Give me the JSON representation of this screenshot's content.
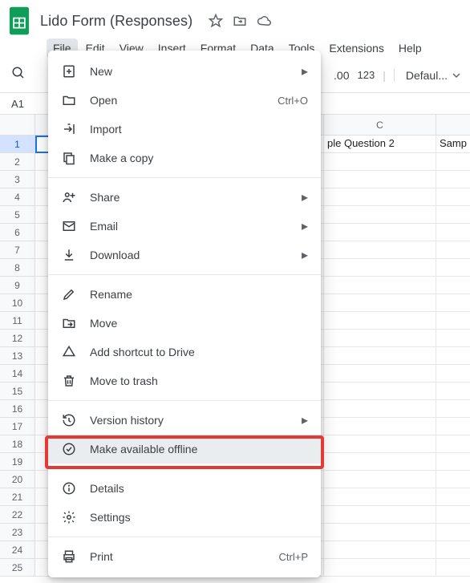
{
  "doc": {
    "title": "Lido Form (Responses)"
  },
  "menubar": [
    "File",
    "Edit",
    "View",
    "Insert",
    "Format",
    "Data",
    "Tools",
    "Extensions",
    "Help"
  ],
  "toolbar": {
    "fmt_suffix": ".00",
    "num_btn": "123",
    "font_select": "Defaul..."
  },
  "namebox": "A1",
  "columns": {
    "c": "C",
    "d_label": "Samp"
  },
  "cells": {
    "c1": "ple Question 2"
  },
  "file_menu": {
    "new": "New",
    "open": "Open",
    "open_shortcut": "Ctrl+O",
    "import": "Import",
    "copy": "Make a copy",
    "share": "Share",
    "email": "Email",
    "download": "Download",
    "rename": "Rename",
    "move": "Move",
    "shortcut": "Add shortcut to Drive",
    "trash": "Move to trash",
    "history": "Version history",
    "offline": "Make available offline",
    "details": "Details",
    "settings": "Settings",
    "print": "Print",
    "print_shortcut": "Ctrl+P"
  }
}
